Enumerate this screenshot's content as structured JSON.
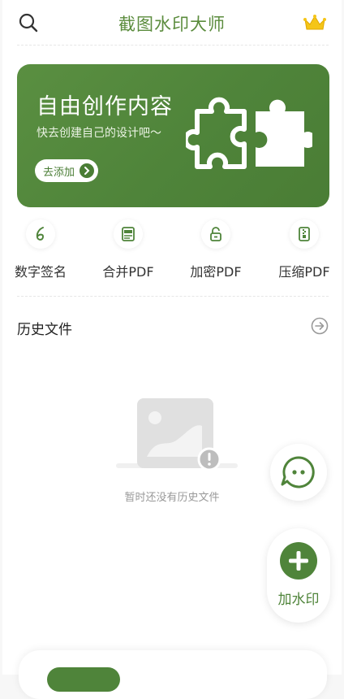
{
  "header": {
    "title": "截图水印大师",
    "search_icon": "search-icon",
    "vip_icon": "crown-icon"
  },
  "banner": {
    "title": "自由创作内容",
    "subtitle": "快去创建自己的设计吧～",
    "button_label": "去添加",
    "illustration": "puzzle-icon"
  },
  "tools": [
    {
      "label": "数字签名",
      "icon": "signature-icon"
    },
    {
      "label": "合并PDF",
      "icon": "pdf-merge-icon"
    },
    {
      "label": "加密PDF",
      "icon": "lock-icon"
    },
    {
      "label": "压缩PDF",
      "icon": "zip-icon"
    }
  ],
  "history": {
    "title": "历史文件",
    "empty_text": "暂时还没有历史文件"
  },
  "fab": {
    "add_label": "加水印",
    "chat_icon": "chat-face-icon",
    "add_icon": "plus-icon"
  },
  "colors": {
    "brand_green": "#4f843a",
    "title_green": "#5b8c3d",
    "background": "#f7f7f7"
  }
}
